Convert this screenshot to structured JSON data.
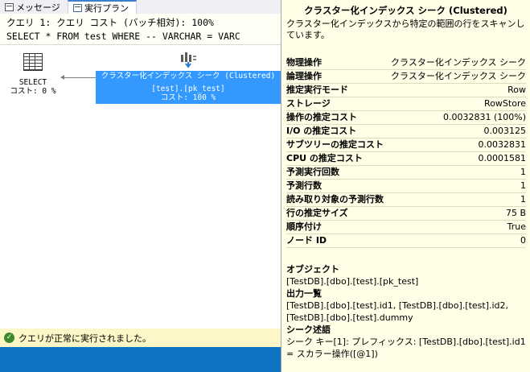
{
  "tabs": [
    {
      "label": "メッセージ",
      "icon": "message-icon"
    },
    {
      "label": "実行プラン",
      "icon": "execution-plan-icon"
    }
  ],
  "query_header": {
    "line1": "クエリ 1: クエリ コスト (バッチ相対): 100%",
    "line2": "SELECT * FROM test WHERE -- VARCHAR = VARC"
  },
  "plan": {
    "select_node": {
      "name": "SELECT",
      "cost": "コスト: 0 %",
      "icon": "select-table-icon"
    },
    "seek_node": {
      "name": "クラスター化インデックス シーク (Clustered)",
      "object": "[test].[pk_test]",
      "cost": "コスト: 100 %",
      "icon": "clustered-index-seek-icon"
    }
  },
  "status": {
    "message": "クエリが正常に実行されました。",
    "icon": "success-check-icon"
  },
  "tooltip": {
    "title": "クラスター化インデックス シーク (Clustered)",
    "description": "クラスター化インデックスから特定の範囲の行をスキャンしています。",
    "properties": [
      {
        "key": "物理操作",
        "value": "クラスター化インデックス シーク"
      },
      {
        "key": "論理操作",
        "value": "クラスター化インデックス シーク"
      },
      {
        "key": "推定実行モード",
        "value": "Row"
      },
      {
        "key": "ストレージ",
        "value": "RowStore"
      },
      {
        "key": "操作の推定コスト",
        "value": "0.0032831 (100%)"
      },
      {
        "key": "I/O の推定コスト",
        "value": "0.003125"
      },
      {
        "key": "サブツリーの推定コスト",
        "value": "0.0032831"
      },
      {
        "key": "CPU の推定コスト",
        "value": "0.0001581"
      },
      {
        "key": "予測実行回数",
        "value": "1"
      },
      {
        "key": "予測行数",
        "value": "1"
      },
      {
        "key": "読み取り対象の予測行数",
        "value": "1"
      },
      {
        "key": "行の推定サイズ",
        "value": "75 B"
      },
      {
        "key": "順序付け",
        "value": "True"
      },
      {
        "key": "ノード ID",
        "value": "0"
      }
    ],
    "object_heading": "オブジェクト",
    "object_value": "[TestDB].[dbo].[test].[pk_test]",
    "output_heading": "出力一覧",
    "output_value": "[TestDB].[dbo].[test].id1, [TestDB].[dbo].[test].id2, [TestDB].[dbo].[test].dummy",
    "seek_heading": "シーク述語",
    "seek_value": "シーク キー[1]: プレフィックス: [TestDB].[dbo].[test].id1 = スカラー操作([@1])"
  },
  "colors": {
    "selected_node": "#3399ff",
    "tooltip_bg": "#fffee6",
    "status_bg": "#fdf6c6",
    "bottom_bar": "#0e72c5"
  }
}
